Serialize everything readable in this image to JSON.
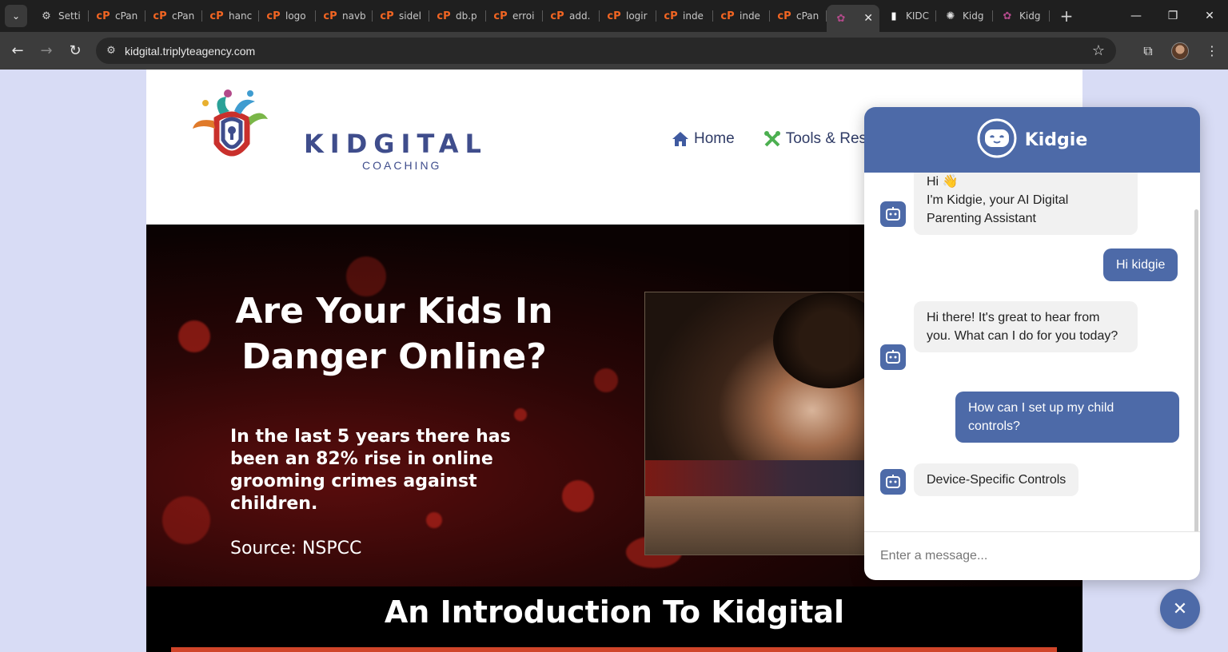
{
  "browser": {
    "tabs": [
      {
        "title": "Setti",
        "icon": "gear-icon"
      },
      {
        "title": "cPan",
        "icon": "cpanel-icon"
      },
      {
        "title": "cPan",
        "icon": "cpanel-icon"
      },
      {
        "title": "hanc",
        "icon": "cpanel-icon"
      },
      {
        "title": "logo",
        "icon": "cpanel-icon"
      },
      {
        "title": "navb",
        "icon": "cpanel-icon"
      },
      {
        "title": "sidel",
        "icon": "cpanel-icon"
      },
      {
        "title": "db.p",
        "icon": "cpanel-icon"
      },
      {
        "title": "erroi",
        "icon": "cpanel-icon"
      },
      {
        "title": "add.",
        "icon": "cpanel-icon"
      },
      {
        "title": "logir",
        "icon": "cpanel-icon"
      },
      {
        "title": "inde",
        "icon": "cpanel-icon"
      },
      {
        "title": "inde",
        "icon": "cpanel-icon"
      },
      {
        "title": "cPan",
        "icon": "cpanel-icon"
      },
      {
        "title": "",
        "icon": "kidgital-icon",
        "active": true
      },
      {
        "title": "KIDC",
        "icon": "page-icon"
      },
      {
        "title": "Kidg",
        "icon": "openai-icon"
      },
      {
        "title": "Kidg",
        "icon": "kidgital-icon"
      }
    ],
    "url": "kidgital.triplyteagency.com"
  },
  "site": {
    "logo": {
      "word": "KIDGITAL",
      "sub": "COACHING"
    },
    "nav": [
      {
        "label": "Home",
        "icon": "home-icon"
      },
      {
        "label": "Tools & Reso",
        "icon": "tools-icon"
      }
    ],
    "hero": {
      "title": "Are Your Kids In Danger Online?",
      "stat": "In the last 5 years there has been an 82% rise in online grooming crimes against children.",
      "source": "Source: NSPCC"
    },
    "intro_title": "An Introduction To Kidgital"
  },
  "chat": {
    "title": "Kidgie",
    "messages": [
      {
        "from": "bot",
        "text": "Hi 👋\nI'm Kidgie, your AI Digital Parenting Assistant"
      },
      {
        "from": "user",
        "text": "Hi kidgie"
      },
      {
        "from": "bot",
        "text": "Hi there! It's great to hear from you. What can I do for you today?"
      },
      {
        "from": "user",
        "text": "How can I set up my child controls?"
      },
      {
        "from": "bot",
        "text": "Device-Specific Controls"
      }
    ],
    "input_placeholder": "Enter a message..."
  },
  "colors": {
    "brand": "#4d6aa8",
    "accent": "#d0452a"
  }
}
